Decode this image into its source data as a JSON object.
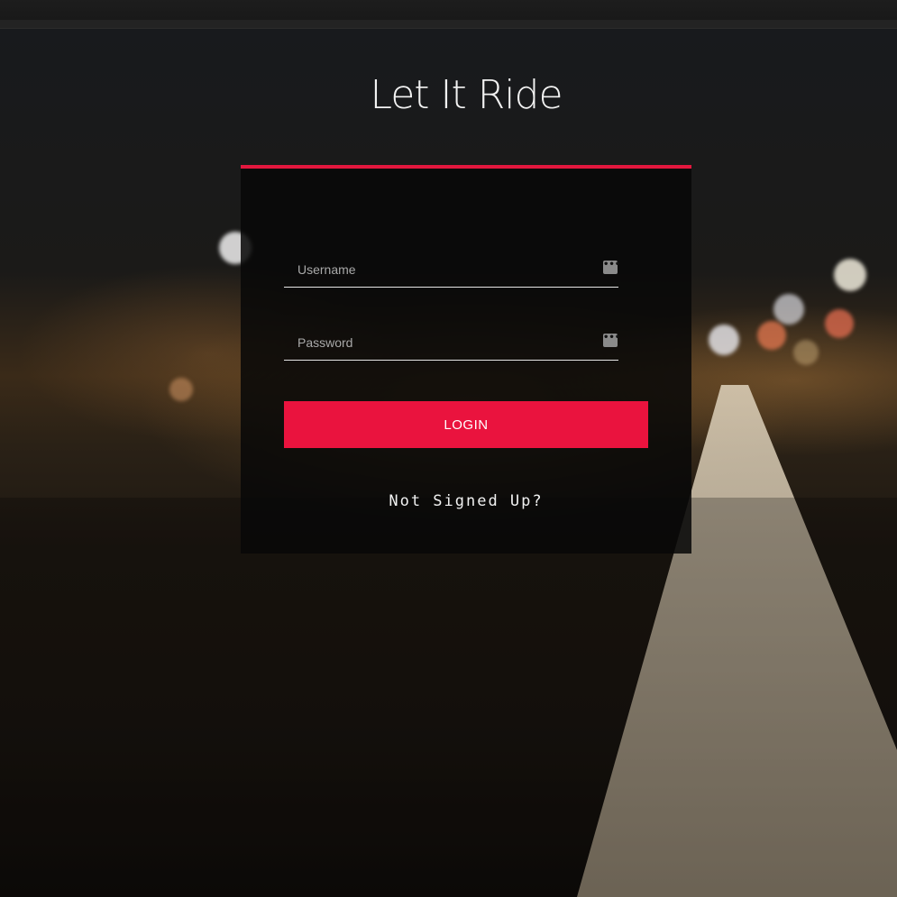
{
  "page": {
    "title": "Let It Ride"
  },
  "login_form": {
    "username_placeholder": "Username",
    "password_placeholder": "Password",
    "field_icon": "more-dots-icon",
    "login_label": "LOGIN",
    "signup_link": "Not Signed Up?"
  },
  "colors": {
    "accent": "#e3173e",
    "button": "#ea133e",
    "card_background": "rgba(8,8,8,0.86)"
  }
}
